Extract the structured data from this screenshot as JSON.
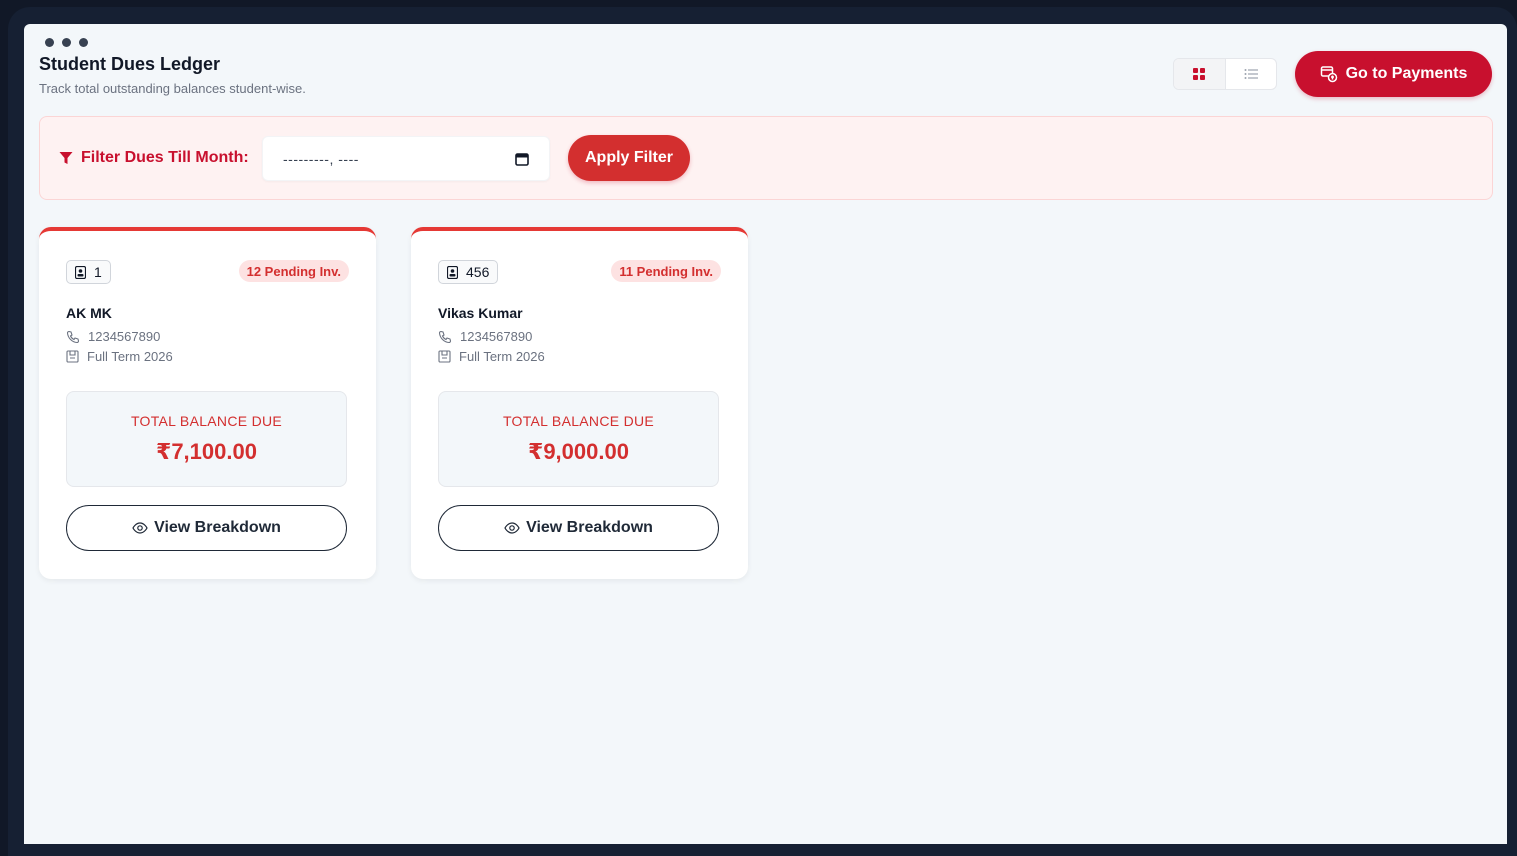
{
  "header": {
    "title": "Student Dues Ledger",
    "subtitle": "Track total outstanding balances student-wise."
  },
  "view_toggle": {
    "grid_icon": "grid-icon",
    "list_icon": "list-icon",
    "active": "grid"
  },
  "payments_button": {
    "label": "Go to Payments",
    "icon": "payments-icon"
  },
  "filter": {
    "label": "Filter Dues Till Month:",
    "icon": "filter-icon",
    "month_value": "---------, ----",
    "calendar_icon": "calendar-icon",
    "apply_label": "Apply Filter"
  },
  "students": [
    {
      "id": "1",
      "pending": "12 Pending Inv.",
      "name": "AK MK",
      "phone": "1234567890",
      "term": "Full Term 2026",
      "balance_label": "TOTAL BALANCE DUE",
      "balance": "₹7,100.00",
      "action": "View Breakdown"
    },
    {
      "id": "456",
      "pending": "11 Pending Inv.",
      "name": "Vikas Kumar",
      "phone": "1234567890",
      "term": "Full Term 2026",
      "balance_label": "TOTAL BALANCE DUE",
      "balance": "₹9,000.00",
      "action": "View Breakdown"
    }
  ],
  "colors": {
    "brand": "#c8102e",
    "accent": "#d32f2f",
    "card_top": "#e53935",
    "filter_bg": "#fef2f2",
    "page_bg": "#f3f7fa"
  }
}
